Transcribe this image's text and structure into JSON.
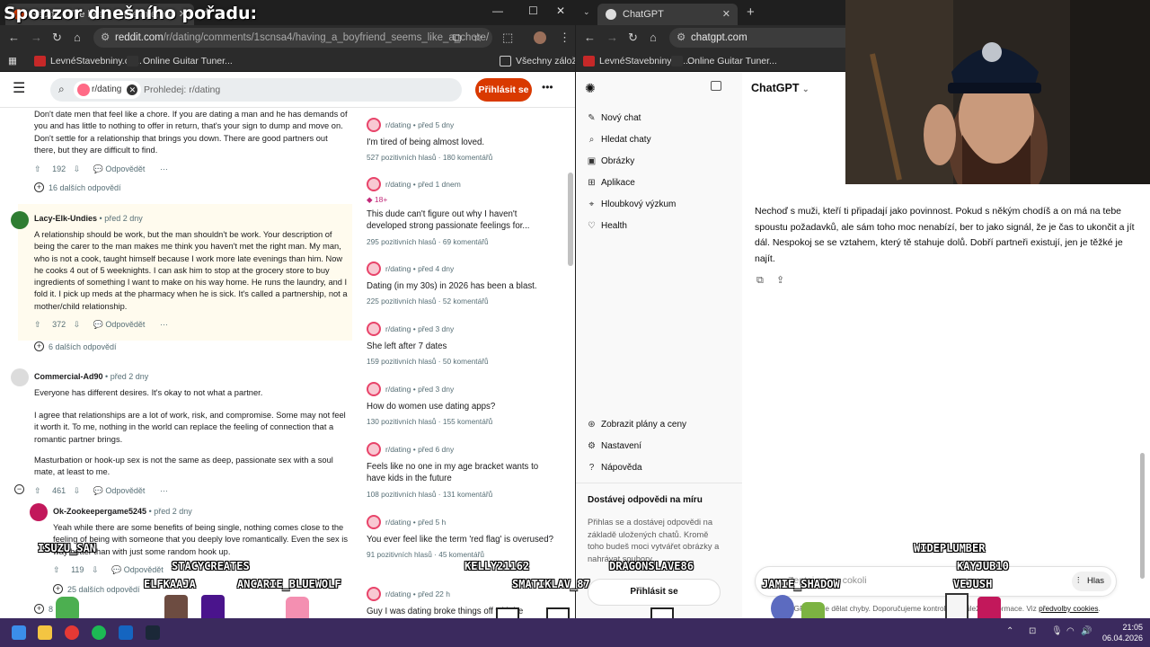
{
  "overlay": {
    "sponsor_label": "Sponzor dnešního pořadu:",
    "chatters": [
      "ISUZU_SAN",
      "STACYCREATES",
      "ELFKAAJA",
      "ANCARIE_BLUEWOLF",
      "KELLY21162",
      "DRAGONSLAVE86",
      "SMATIKLAV_87",
      "WIDEPLUMBER",
      "KAYJUB10",
      "JAMIE_SHADOW",
      "VEJUSH"
    ]
  },
  "left_browser": {
    "tab_title": "Reddit - The heart of the internet",
    "url_domain": "reddit.com",
    "url_path": "/r/dating/comments/1scnsa4/having_a_boyfriend_seems_like_a_chore/",
    "bookmarks": [
      "LevnéStavebniny.cz...",
      "Online Guitar Tuner..."
    ],
    "bookmarks_all": "Všechny záložky"
  },
  "right_browser": {
    "tab_title": "ChatGPT",
    "url": "chatgpt.com",
    "bookmarks": [
      "LevnéStavebniny.cz...",
      "Online Guitar Tuner..."
    ]
  },
  "reddit": {
    "community_chip": "r/dating",
    "search_placeholder": "Prohledej: r/dating",
    "login_label": "Přihlásit se",
    "more_label": "•••",
    "reply_label": "Odpovědět",
    "comments": [
      {
        "text": "Don't date men that feel like a chore. If you are dating a man and he has demands of you and has little to nothing to offer in return, that's your sign to dump and move on. Don't settle for a relationship that brings you down. There are good partners out there, but they are difficult to find.",
        "votes": "192",
        "more_replies": "16 dalších odpovědí"
      },
      {
        "author": "Lacy-Elk-Undies",
        "time": "• před 2 dny",
        "text": "A relationship should be work, but the man shouldn't be work. Your description of being the carer to the man makes me think you haven't met the right man. My man, who is not a cook, taught himself because I work more late evenings than him. Now he cooks 4 out of 5 weeknights. I can ask him to stop at the grocery store to buy ingredients of something I want to make on his way home. He runs the laundry, and I fold it. I pick up meds at the pharmacy when he is sick. It's called a partnership, not a mother/child relationship.",
        "votes": "372",
        "more_replies": "6 dalších odpovědí"
      },
      {
        "author": "Commercial-Ad90",
        "time": "• před 2 dny",
        "paragraphs": [
          "Everyone has different desires. It's okay to not what a partner.",
          "I agree that relationships are a lot of work, risk, and compromise. Some may not feel it worth it. To me, nothing in the world can replace the feeling of connection that a romantic partner brings.",
          "Masturbation or hook-up sex is not the same as deep, passionate sex with a soul mate, at least to me."
        ],
        "votes": "461"
      },
      {
        "author": "Ok-Zookeepergame5245",
        "time": "• před 2 dny",
        "text": "Yeah while there are some benefits of being single, nothing comes close to the feeling of being with someone that you deeply love romantically. Even the sex is way better than with just some random hook up.",
        "votes": "119",
        "more_replies": "25 dalších odpovědí",
        "extra": "8"
      }
    ],
    "related_posts": [
      {
        "sub": "r/dating",
        "time": "• před 5 dny",
        "title": "I'm tired of being almost loved.",
        "votes": "527 pozitivních hlasů",
        "comments": "180 komentářů"
      },
      {
        "sub": "r/dating",
        "time": "• před 1 dnem",
        "badge": "18+",
        "title": "This dude can't figure out why I haven't developed strong passionate feelings for...",
        "votes": "295 pozitivních hlasů",
        "comments": "69 komentářů"
      },
      {
        "sub": "r/dating",
        "time": "• před 4 dny",
        "title": "Dating (in my 30s) in 2026 has been a blast.",
        "votes": "225 pozitivních hlasů",
        "comments": "52 komentářů"
      },
      {
        "sub": "r/dating",
        "time": "• před 3 dny",
        "title": "She left after 7 dates",
        "votes": "159 pozitivních hlasů",
        "comments": "50 komentářů"
      },
      {
        "sub": "r/dating",
        "time": "• před 3 dny",
        "title": "How do women use dating apps?",
        "votes": "130 pozitivních hlasů",
        "comments": "155 komentářů"
      },
      {
        "sub": "r/dating",
        "time": "• před 6 dny",
        "title": "Feels like no one in my age bracket wants to have kids in the future",
        "votes": "108 pozitivních hlasů",
        "comments": "131 komentářů"
      },
      {
        "sub": "r/dating",
        "time": "• před 5 h",
        "title": "You ever feel like the term 'red flag' is overused?",
        "votes": "91 pozitivních hlasů",
        "comments": "45 komentářů"
      },
      {
        "sub": "r/dating",
        "time": "• před 22 h",
        "title": "Guy I was dating broke things off with he"
      }
    ]
  },
  "chatgpt": {
    "model_label": "ChatGPT",
    "sidebar_items": [
      "Nový chat",
      "Hledat chaty",
      "Obrázky",
      "Aplikace",
      "Hloubkový výzkum",
      "Health"
    ],
    "bottom_items": [
      "Zobrazit plány a ceny",
      "Nastavení",
      "Nápověda"
    ],
    "promo_title": "Dostávej odpovědi na míru",
    "promo_text": "Přihlas se a dostávej odpovědi na základě uložených chatů. Kromě toho budeš moci vytvářet obrázky a nahrávat soubory.",
    "promo_button": "Přihlásit se",
    "message": "Nechoď s muži, kteří ti připadají jako povinnost. Pokud s někým chodíš a on má na tebe spoustu požadavků, ale sám toho moc nenabízí, ber to jako signál, že je čas to ukončit a jít dál. Nespokoj se se vztahem, který tě stahuje dolů. Dobří partneři existují, jen je těžké je najít.",
    "composer_placeholder": "Zeptej se na cokoli",
    "voice_label": "Hlas",
    "disclaimer": "ChatGPT může dělat chyby. Doporučujeme kontrolovat důležité informace. Viz",
    "disclaimer_link": "předvolby cookies",
    "disclaimer_end": "."
  },
  "taskbar": {
    "time": "21:05",
    "date": "06.04.2026"
  }
}
